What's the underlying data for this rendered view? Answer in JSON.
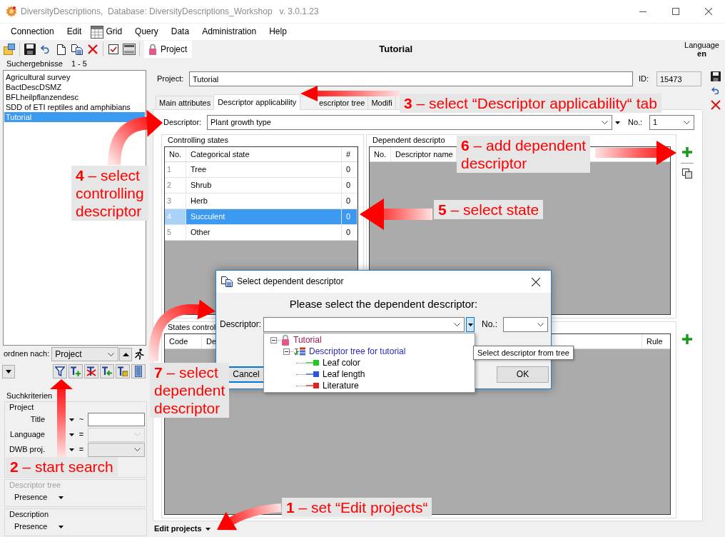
{
  "window": {
    "title": "DiversityDescriptions,  Database: DiversityDescriptions_Workshop   v. 3.0.1.23"
  },
  "menu": [
    {
      "label": "Connection",
      "kind": "text"
    },
    {
      "label": "Edit",
      "kind": "text"
    },
    {
      "label": "Grid",
      "kind": "icon"
    },
    {
      "label": "Query",
      "kind": "text"
    },
    {
      "label": "Data",
      "kind": "text"
    },
    {
      "label": "Administration",
      "kind": "text"
    },
    {
      "label": "Help",
      "kind": "text"
    }
  ],
  "toolbar": {
    "section": "Project",
    "title": "Tutorial",
    "language_label": "Language",
    "language": "en"
  },
  "search_results": {
    "header": "Suchergebnisse",
    "range": "1 - 5",
    "items": [
      {
        "label": "Agricultural survey",
        "selected": false
      },
      {
        "label": "BactDescDSMZ",
        "selected": false
      },
      {
        "label": "BFLheilpflanzendesc",
        "selected": false
      },
      {
        "label": "SDD of ETI reptiles and amphibians",
        "selected": false
      },
      {
        "label": "Tutorial",
        "selected": true
      }
    ]
  },
  "sort": {
    "label": "ordnen nach:",
    "value": "Project"
  },
  "search_criteria": {
    "title": "Suchkriterien",
    "groups": [
      {
        "title": "Project",
        "disabled": false,
        "fields": [
          {
            "label": "Title",
            "operator": "~",
            "kind": "text",
            "disabled": false
          },
          {
            "label": "Language",
            "operator": "=",
            "kind": "combo",
            "disabled": true
          },
          {
            "label": "DWB proj.",
            "operator": "=",
            "kind": "combo",
            "disabled": false
          }
        ]
      },
      {
        "title": "Descriptor tree",
        "disabled": true,
        "fields": [
          {
            "label": "Presence",
            "kind": "presence",
            "disabled": false
          }
        ]
      },
      {
        "title": "Description",
        "disabled": false,
        "fields": [
          {
            "label": "Presence",
            "kind": "presence",
            "disabled": false
          }
        ]
      }
    ]
  },
  "project": {
    "label": "Project:",
    "value": "Tutorial",
    "id_label": "ID:",
    "id": "15473"
  },
  "tabs": [
    {
      "label": "Main attributes",
      "selected": false
    },
    {
      "label": "Descriptor applicability",
      "selected": true
    },
    {
      "label": "escriptor tree",
      "selected": false
    },
    {
      "label": "Modifi",
      "selected": false
    }
  ],
  "descriptor": {
    "label": "Descriptor:",
    "value": "Plant growth type",
    "no_label": "No.:",
    "no": "1"
  },
  "controlling_states": {
    "title": "Controlling states",
    "columns": [
      "No.",
      "Categorical state",
      "#"
    ],
    "rows": [
      {
        "no": "1",
        "state": "Tree",
        "count": "0",
        "selected": false
      },
      {
        "no": "2",
        "state": "Shrub",
        "count": "0",
        "selected": false
      },
      {
        "no": "3",
        "state": "Herb",
        "count": "0",
        "selected": false
      },
      {
        "no": "4",
        "state": "Succulent",
        "count": "0",
        "selected": true
      },
      {
        "no": "5",
        "state": "Other",
        "count": "0",
        "selected": false
      }
    ]
  },
  "dependent_descriptors": {
    "title": "Dependent descripto",
    "columns": [
      "No.",
      "Descriptor name"
    ]
  },
  "states_controlled": {
    "title": "States control",
    "columns": [
      "Code",
      "De",
      "Rule"
    ]
  },
  "status_bar": {
    "mode": "Edit projects"
  },
  "dialog": {
    "title": "Select dependent descriptor",
    "prompt": "Please select the dependent descriptor:",
    "descriptor_label": "Descriptor:",
    "no_label": "No.:",
    "tree": [
      {
        "label": "Tutorial",
        "kind": "project",
        "expanded": true,
        "children": [
          {
            "label": "Descriptor tree for tutorial",
            "kind": "tree",
            "expanded": true,
            "children": [
              {
                "label": "Leaf color",
                "kind": "descriptor",
                "color": "#22c822"
              },
              {
                "label": "Leaf length",
                "kind": "descriptor",
                "color": "#2a56e0"
              },
              {
                "label": "Literature",
                "kind": "descriptor",
                "color": "#e02424"
              }
            ]
          }
        ]
      }
    ],
    "tooltip": "Select descriptor from tree",
    "buttons": [
      {
        "label": "Cancel",
        "focused": true
      },
      {
        "label": "OK",
        "focused": false
      }
    ]
  },
  "annotations": [
    {
      "text": "**3** – select “Descriptor applicability“ tab"
    },
    {
      "text": "**6** – add dependent\ndescriptor"
    },
    {
      "text": "**4** – select\ncontrolling\ndescriptor"
    },
    {
      "text": "**5** – select state"
    },
    {
      "text": "**7** – select\ndependent\ndescriptor"
    },
    {
      "text": "**2** – start search"
    },
    {
      "text": "**1** – set “Edit projects“"
    }
  ]
}
